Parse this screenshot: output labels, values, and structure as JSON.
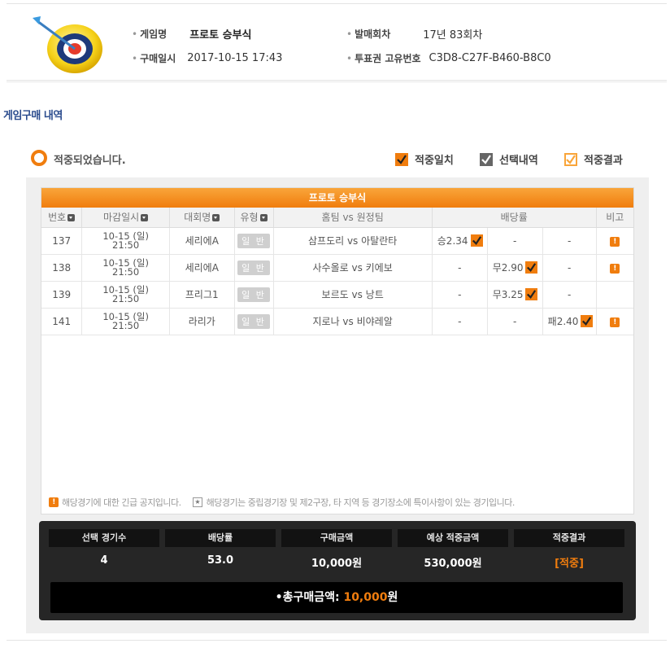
{
  "header": {
    "game_label": "게임명",
    "game_value": "프로토 승부식",
    "round_label": "발매회차",
    "round_value": "17년 83회차",
    "purchase_label": "구매일시",
    "purchase_value": "2017-10-15 17:43",
    "ticket_label": "투표권 고유번호",
    "ticket_value": "C3D8-C27F-B460-B8C0"
  },
  "section_title": "게임구매 내역",
  "status": {
    "hit_text": "적중되었습니다.",
    "legend": [
      {
        "label": "적중일치",
        "color": "#f07d0e",
        "icon": "check-filled-orange-icon"
      },
      {
        "label": "선택내역",
        "color": "#666666",
        "icon": "check-filled-gray-icon"
      },
      {
        "label": "적중결과",
        "color": "#f9a53a",
        "icon": "check-outline-orange-icon"
      }
    ]
  },
  "table": {
    "title": "프로토 승부식",
    "headers": {
      "no": "번호",
      "deadline": "마감일시",
      "league": "대회명",
      "type": "유형",
      "match": "홈팀 vs 원정팀",
      "odds": "배당률",
      "note": "비고"
    },
    "rows": [
      {
        "no": "137",
        "date": "10-15 (일)",
        "time": "21:50",
        "league": "세리에A",
        "type": "일 반",
        "match": "삼프도리 vs 아탈란타",
        "o1": "승2.34",
        "o2": "-",
        "o3": "-",
        "checked": 1,
        "alert": true
      },
      {
        "no": "138",
        "date": "10-15 (일)",
        "time": "21:50",
        "league": "세리에A",
        "type": "일 반",
        "match": "사수올로 vs 키에보",
        "o1": "-",
        "o2": "무2.90",
        "o3": "-",
        "checked": 2,
        "alert": true
      },
      {
        "no": "139",
        "date": "10-15 (일)",
        "time": "21:50",
        "league": "프리그1",
        "type": "일 반",
        "match": "보르도 vs 낭트",
        "o1": "-",
        "o2": "무3.25",
        "o3": "-",
        "checked": 2,
        "alert": false
      },
      {
        "no": "141",
        "date": "10-15 (일)",
        "time": "21:50",
        "league": "라리가",
        "type": "일 반",
        "match": "지로나 vs 비야레알",
        "o1": "-",
        "o2": "-",
        "o3": "패2.40",
        "checked": 3,
        "alert": true
      }
    ],
    "alert_glyph": "!"
  },
  "notice": {
    "alert_text": "해당경기에 대한 긴급 공지입니다.",
    "star_text": "해당경기는 중립경기장 및 제2구장, 타 지역 등 경기장소에 특이사항이 있는 경기입니다."
  },
  "summary": {
    "cells": [
      {
        "label": "선택 경기수",
        "value": "4"
      },
      {
        "label": "배당률",
        "value": "53.0"
      },
      {
        "label": "구매금액",
        "value": "10,000원"
      },
      {
        "label": "예상 적중금액",
        "value": "530,000원"
      },
      {
        "label": "적중결과",
        "value": "[적중]"
      }
    ],
    "total_label": "•총구매금액: ",
    "total_amount": "10,000",
    "total_unit": "원"
  },
  "colors": {
    "accent": "#f07d0e",
    "summary_bg": "#262626",
    "title_blue": "#2a4b8d"
  }
}
